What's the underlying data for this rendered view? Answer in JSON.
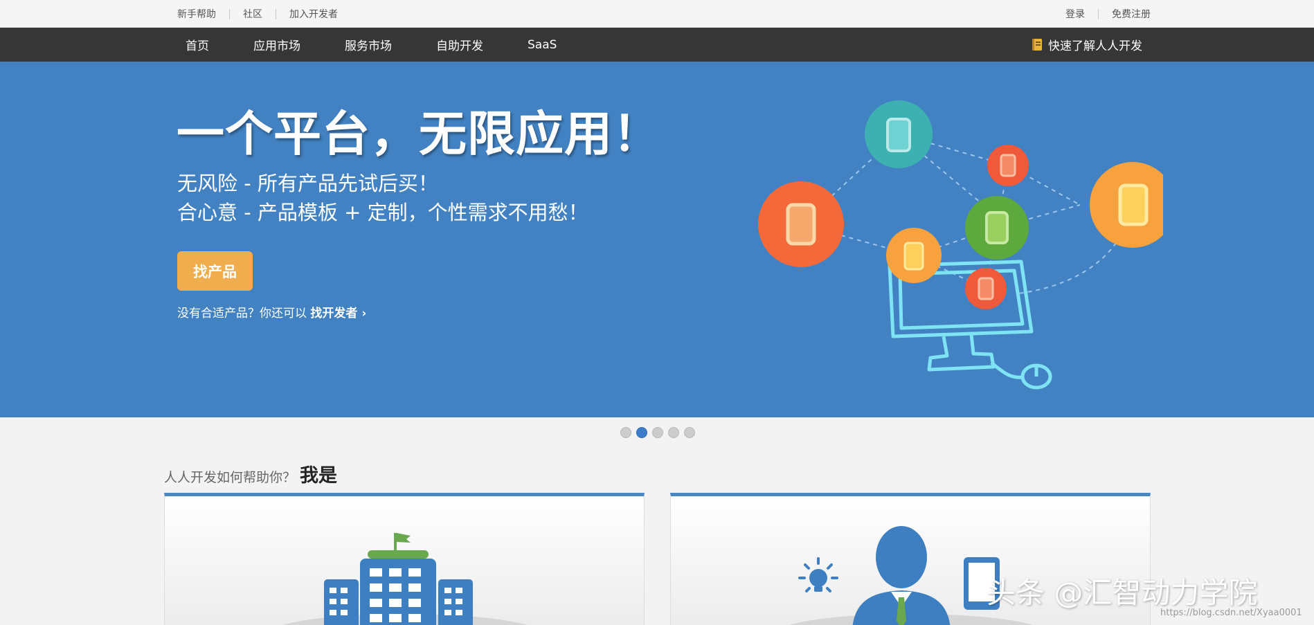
{
  "topbar": {
    "left_links": [
      "新手帮助",
      "社区",
      "加入开发者"
    ],
    "right_links": [
      "登录",
      "免费注册"
    ]
  },
  "nav": {
    "items": [
      "首页",
      "应用市场",
      "服务市场",
      "自助开发",
      "SaaS"
    ],
    "quick_link": "快速了解人人开发",
    "quick_icon": "book-icon"
  },
  "hero": {
    "title": "一个平台，无限应用！",
    "line1": "无风险 - 所有产品先试后买！",
    "line2": "合心意 - 产品模板 + 定制，个性需求不用愁！",
    "cta_label": "找产品",
    "sub_prefix": "没有合适产品？你还可以",
    "sub_link": "找开发者",
    "sub_arrow": "›",
    "background": "#4282c2",
    "cta_color": "#f0ad4e",
    "illustration": "connected-devices-illustration"
  },
  "carousel": {
    "count": 5,
    "active_index": 1
  },
  "help": {
    "question": "人人开发如何帮助你？",
    "emphasis": "我是",
    "cards": [
      {
        "illustration": "company-building-illustration"
      },
      {
        "illustration": "individual-person-illustration"
      }
    ]
  },
  "watermark": {
    "text": "头条 @汇智动力学院",
    "url": "https://blog.csdn.net/Xyaa0001"
  },
  "colors": {
    "nav_bg": "#363636",
    "accent_blue": "#4a86c0",
    "dot_active": "#3d7cc9"
  }
}
